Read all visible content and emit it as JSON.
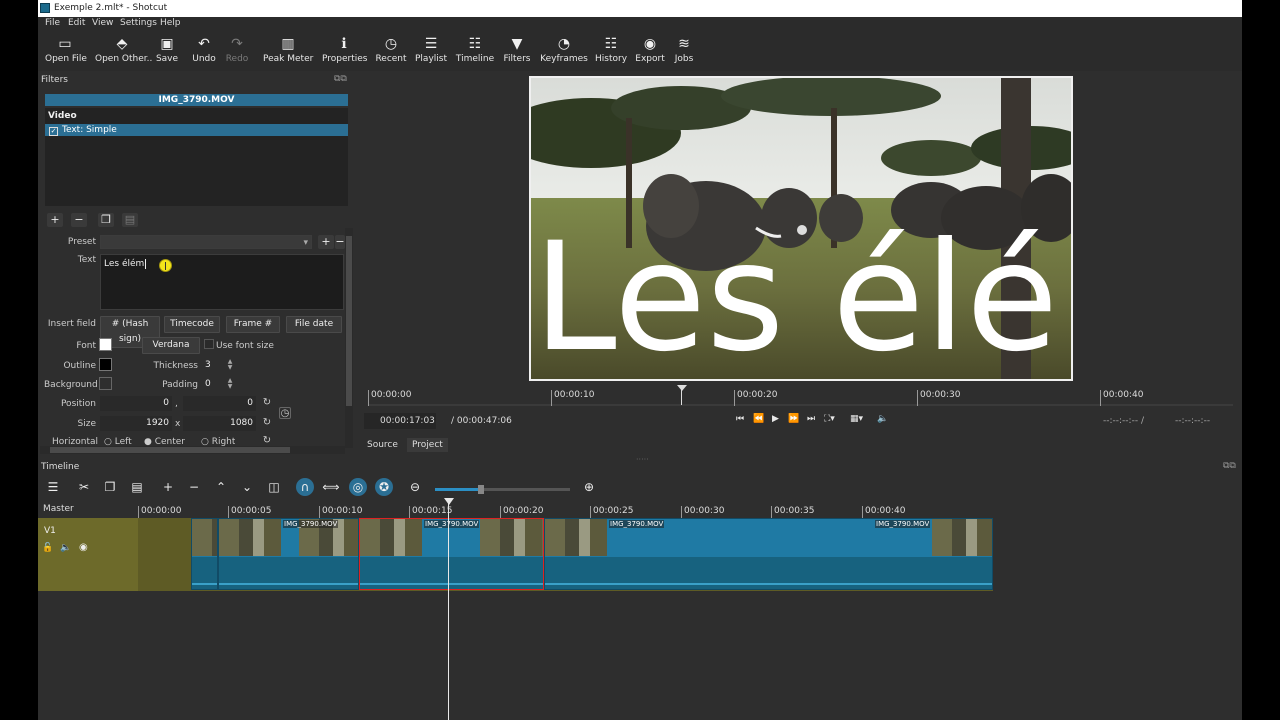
{
  "window": {
    "title": "Exemple 2.mlt* - Shotcut"
  },
  "menu": [
    "File",
    "Edit",
    "View",
    "Settings",
    "Help"
  ],
  "toolbar": [
    {
      "label": "Open File",
      "icon": "folder-open-icon",
      "glyph": "▭"
    },
    {
      "label": "Open Other..",
      "icon": "open-other-icon",
      "glyph": "⬘"
    },
    {
      "label": "Save",
      "icon": "save-icon",
      "glyph": "▣"
    },
    {
      "label": "Undo",
      "icon": "undo-icon",
      "glyph": "↶"
    },
    {
      "label": "Redo",
      "icon": "redo-icon",
      "glyph": "↷"
    },
    {
      "label": "Peak Meter",
      "icon": "peak-meter-icon",
      "glyph": "▥"
    },
    {
      "label": "Properties",
      "icon": "info-icon",
      "glyph": "ℹ"
    },
    {
      "label": "Recent",
      "icon": "clock-icon",
      "glyph": "◷"
    },
    {
      "label": "Playlist",
      "icon": "list-icon",
      "glyph": "☰"
    },
    {
      "label": "Timeline",
      "icon": "timeline-icon",
      "glyph": "☷"
    },
    {
      "label": "Filters",
      "icon": "funnel-icon",
      "glyph": "▼"
    },
    {
      "label": "Keyframes",
      "icon": "stopwatch-icon",
      "glyph": "◔"
    },
    {
      "label": "History",
      "icon": "history-icon",
      "glyph": "☷"
    },
    {
      "label": "Export",
      "icon": "export-icon",
      "glyph": "◉"
    },
    {
      "label": "Jobs",
      "icon": "jobs-icon",
      "glyph": "≋"
    }
  ],
  "filters": {
    "panel_title": "Filters",
    "clip_name": "IMG_3790.MOV",
    "group": "Video",
    "item": "Text: Simple",
    "preset_label": "Preset",
    "text_label": "Text",
    "text_value": "Les élém",
    "insert_field_label": "Insert field",
    "insert_buttons": [
      "# (Hash sign)",
      "Timecode",
      "Frame #",
      "File date"
    ],
    "font_label": "Font",
    "font_button": "Verdana",
    "use_font_size": "Use font size",
    "outline_label": "Outline",
    "thickness_label": "Thickness",
    "thickness_value": "3",
    "background_label": "Background",
    "padding_label": "Padding",
    "padding_value": "0",
    "position_label": "Position",
    "position_x": "0",
    "position_y": "0",
    "size_label": "Size",
    "size_w": "1920",
    "size_h": "1080",
    "size_sep": "x",
    "pos_sep": ",",
    "hfit_label": "Horizontal fit",
    "hfit_options": [
      "Left",
      "Center",
      "Right"
    ]
  },
  "viewer": {
    "overlay_text": "Les élé",
    "ruler": [
      "00:00:00",
      "00:00:10",
      "00:00:20",
      "00:00:30",
      "00:00:40"
    ],
    "current_time": "00:00:17:03",
    "total_time": "/ 00:00:47:06",
    "in_point": "--:--:--:-- /",
    "out_point": "--:--:--:--",
    "tabs": [
      "Source",
      "Project"
    ]
  },
  "timeline": {
    "panel_title": "Timeline",
    "master_label": "Master",
    "track_label": "V1",
    "ruler": [
      "00:00:00",
      "00:00:05",
      "00:00:10",
      "00:00:15",
      "00:00:20",
      "00:00:25",
      "00:00:30",
      "00:00:35",
      "00:00:40"
    ],
    "clip_name": "IMG_3790.MOV"
  },
  "colors": {
    "accent": "#2b6f94",
    "clip": "#1f7aa4",
    "track": "#6d6a2a",
    "selected_border": "#dd2222",
    "cursor_highlight": "#f2e51a"
  }
}
